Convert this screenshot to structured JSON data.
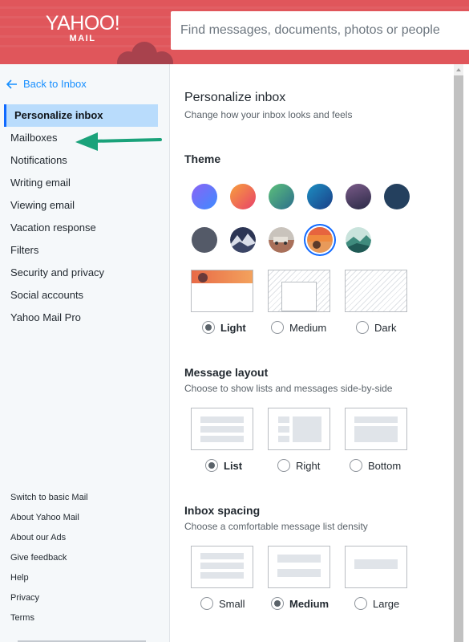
{
  "header": {
    "logo_word": "YAHOO!",
    "logo_sub": "MAIL",
    "search_placeholder": "Find messages, documents, photos or people",
    "brand_color": "#e0565b"
  },
  "sidebar": {
    "back_label": "Back to Inbox",
    "items": [
      {
        "label": "Personalize inbox",
        "active": true
      },
      {
        "label": "Mailboxes"
      },
      {
        "label": "Notifications"
      },
      {
        "label": "Writing email"
      },
      {
        "label": "Viewing email"
      },
      {
        "label": "Vacation response"
      },
      {
        "label": "Filters"
      },
      {
        "label": "Security and privacy"
      },
      {
        "label": "Social accounts"
      },
      {
        "label": "Yahoo Mail Pro"
      }
    ],
    "footer_links": [
      "Switch to basic Mail",
      "About Yahoo Mail",
      "About our Ads",
      "Give feedback",
      "Help",
      "Privacy",
      "Terms"
    ],
    "annotation_arrow_color": "#1aa27a"
  },
  "main": {
    "title": "Personalize inbox",
    "subtitle": "Change how your inbox looks and feels",
    "theme": {
      "title": "Theme",
      "swatches_row1": [
        "violet-gradient",
        "orange-gradient",
        "green-gradient",
        "blue-gradient",
        "dusk-gradient",
        "navy"
      ],
      "swatches_row2": [
        "slate",
        "night-mountains",
        "desert-scene",
        "sunset-scene (selected)",
        "teal-mountains"
      ],
      "modes": [
        {
          "label": "Light",
          "selected": true
        },
        {
          "label": "Medium",
          "selected": false
        },
        {
          "label": "Dark",
          "selected": false
        }
      ]
    },
    "layout": {
      "title": "Message layout",
      "subtitle": "Choose to show lists and messages side-by-side",
      "options": [
        {
          "label": "List",
          "selected": true
        },
        {
          "label": "Right",
          "selected": false
        },
        {
          "label": "Bottom",
          "selected": false
        }
      ]
    },
    "spacing": {
      "title": "Inbox spacing",
      "subtitle": "Choose a comfortable message list density",
      "options": [
        {
          "label": "Small",
          "selected": false
        },
        {
          "label": "Medium",
          "selected": true
        },
        {
          "label": "Large",
          "selected": false
        }
      ]
    }
  }
}
